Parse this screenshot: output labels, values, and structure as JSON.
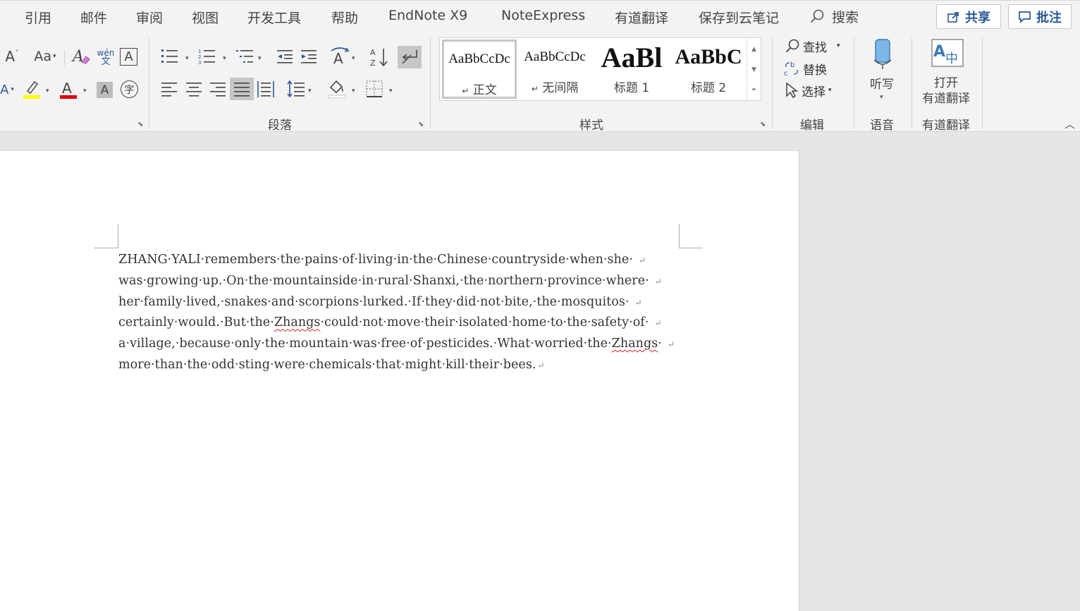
{
  "tabs": [
    {
      "label": "引用"
    },
    {
      "label": "邮件"
    },
    {
      "label": "审阅"
    },
    {
      "label": "视图"
    },
    {
      "label": "开发工具"
    },
    {
      "label": "帮助"
    },
    {
      "label": "EndNote X9"
    },
    {
      "label": "NoteExpress"
    },
    {
      "label": "有道翻译"
    },
    {
      "label": "保存到云笔记"
    }
  ],
  "search": {
    "label": "搜索",
    "icon": "search-icon"
  },
  "share_button": {
    "label": "共享",
    "icon": "share-icon"
  },
  "comments_button": {
    "label": "批注",
    "icon": "comment-icon"
  },
  "font_group": {
    "change_case_label": "Aa",
    "phonetic_top": "wén",
    "phonetic_bottom": "文",
    "char_border": "A",
    "font_color_letter": "A",
    "char_shading": "A",
    "enclose_char": "字",
    "highlight_color": "#ffff00",
    "font_color": "#e00000"
  },
  "paragraph_group": {
    "label": "段落"
  },
  "styles_group": {
    "label": "样式",
    "items": [
      {
        "preview": "AaBbCcDc",
        "name": "正文",
        "mark": "↵"
      },
      {
        "preview": "AaBbCcDc",
        "name": "无间隔",
        "mark": "↵"
      },
      {
        "preview": "AaBl",
        "name": "标题 1"
      },
      {
        "preview": "AaBbC",
        "name": "标题 2"
      }
    ]
  },
  "editing_group": {
    "label": "编辑",
    "find": "查找",
    "replace": "替换",
    "select": "选择"
  },
  "voice_group": {
    "label": "语音",
    "dictate": "听写"
  },
  "youdao_group": {
    "label": "有道翻译",
    "open_line1": "打开",
    "open_line2": "有道翻译"
  },
  "document": {
    "lines": [
      "ZHANG·YALI·remembers·the·pains·of·living·in·the·Chinese·countryside·when·she·",
      "was·growing·up.·On·the·mountainside·in·rural·Shanxi,·the·northern·province·where·",
      "her·family·lived,·snakes·and·scorpions·lurked.·If·they·did·not·bite,·the·mosquitos·",
      "certainly·would.·But·the·",
      "Zhangs",
      "·could·not·move·their·isolated·home·to·the·safety·of·",
      "a·village,·because·only·the·mountain·was·free·of·pesticides.·What·worried·the·",
      "Zhangs",
      "·",
      "more·than·the·odd·sting·were·chemicals·that·might·kill·their·bees."
    ],
    "para_mark": "↵"
  }
}
